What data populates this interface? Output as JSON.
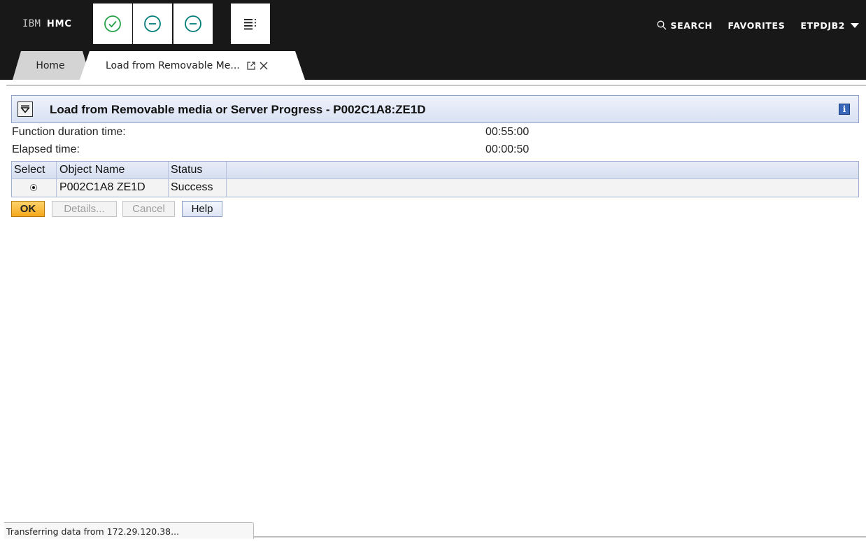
{
  "header": {
    "brand_prefix": "IBM",
    "brand_name": "HMC",
    "toolbar_icons": [
      "check-circle-icon",
      "minus-circle-icon",
      "minus-circle-icon",
      "list-menu-icon"
    ],
    "nav": {
      "search_label": "SEARCH",
      "favorites_label": "FAVORITES",
      "user_label": "ETPDJB2"
    }
  },
  "tabs": [
    {
      "label": "Home",
      "active": false
    },
    {
      "label": "Load from Removable Me...",
      "active": true
    }
  ],
  "panel": {
    "title": "Load from Removable media or Server Progress - P002C1A8:ZE1D",
    "info_icon": "i",
    "fields": [
      {
        "label": "Function duration time:",
        "value": "00:55:00"
      },
      {
        "label": "Elapsed time:",
        "value": "00:00:50"
      }
    ],
    "table": {
      "columns": [
        "Select",
        "Object Name",
        "Status"
      ],
      "rows": [
        {
          "selected": true,
          "object_name": "P002C1A8 ZE1D",
          "status": "Success"
        }
      ]
    },
    "buttons": {
      "ok": "OK",
      "details": "Details...",
      "cancel": "Cancel",
      "help": "Help"
    }
  },
  "status_bar": {
    "text": "Transferring data from 172.29.120.38..."
  },
  "colors": {
    "topbar": "#181818",
    "ok_button": "#f4a81c",
    "icon_green": "#24a148",
    "icon_teal": "#007d79",
    "panel_border": "#8fa1c7"
  }
}
